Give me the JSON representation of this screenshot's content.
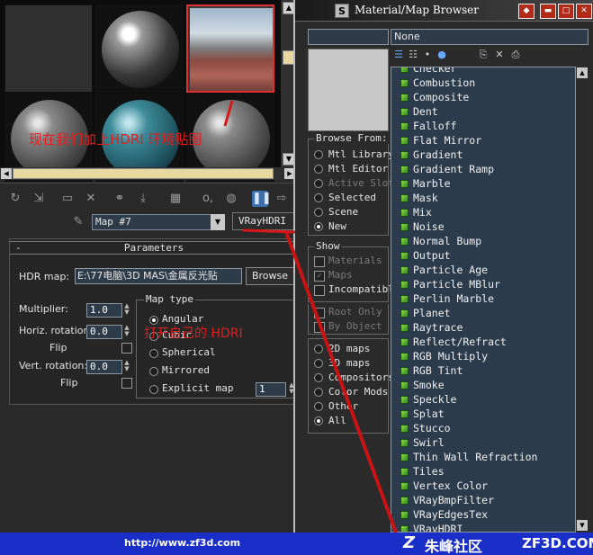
{
  "material_editor": {
    "map_name": "Map #7",
    "map_type_button": "VRayHDRI",
    "params": {
      "title": "Parameters",
      "collapse": "-",
      "hdr_map_label": "HDR map:",
      "hdr_map_path": "E:\\77电脑\\3D MAS\\金属反光贴",
      "browse_label": "Browse",
      "multiplier_label": "Multiplier:",
      "multiplier_value": "1.0",
      "horiz_rotation_label": "Horiz. rotation:",
      "horiz_rotation_value": "0.0",
      "flip_label": "Flip",
      "vert_rotation_label": "Vert. rotation:",
      "vert_rotation_value": "0.0",
      "flip2_label": "Flip",
      "map_type_title": "Map type",
      "map_types": [
        "Angular",
        "Cubic",
        "Spherical",
        "Mirrored",
        "Explicit map"
      ],
      "explicit_map_channel": "1"
    },
    "annotations": {
      "top": "现在我们加上HDRI 环境贴图",
      "mid": "打开自己的 HDRI"
    }
  },
  "browser": {
    "title": "Material/Map Browser",
    "title_icon": "S",
    "filter_value": "None",
    "browse_from": {
      "title": "Browse From:",
      "items": [
        {
          "label": "Mtl Library",
          "enabled": true,
          "selected": false
        },
        {
          "label": "Mtl Editor",
          "enabled": true,
          "selected": false
        },
        {
          "label": "Active Slot",
          "enabled": false,
          "selected": false
        },
        {
          "label": "Selected",
          "enabled": true,
          "selected": false
        },
        {
          "label": "Scene",
          "enabled": true,
          "selected": false
        },
        {
          "label": "New",
          "enabled": true,
          "selected": true
        }
      ]
    },
    "show": {
      "title": "Show",
      "items": [
        {
          "label": "Materials",
          "enabled": false,
          "checked": false
        },
        {
          "label": "Maps",
          "enabled": false,
          "checked": true
        },
        {
          "label": "Incompatible",
          "enabled": true,
          "checked": false
        }
      ],
      "extra": [
        {
          "label": "Root Only",
          "enabled": false
        },
        {
          "label": "By Object",
          "enabled": false
        }
      ]
    },
    "categories": {
      "items": [
        {
          "label": "2D maps",
          "selected": false
        },
        {
          "label": "3D maps",
          "selected": false
        },
        {
          "label": "Compositors",
          "selected": false
        },
        {
          "label": "Color Mods",
          "selected": false
        },
        {
          "label": "Other",
          "selected": false
        },
        {
          "label": "All",
          "selected": true
        }
      ]
    },
    "map_list": [
      "Checker",
      "Combustion",
      "Composite",
      "Dent",
      "Falloff",
      "Flat Mirror",
      "Gradient",
      "Gradient Ramp",
      "Marble",
      "Mask",
      "Mix",
      "Noise",
      "Normal Bump",
      "Output",
      "Particle Age",
      "Particle MBlur",
      "Perlin Marble",
      "Planet",
      "Raytrace",
      "Reflect/Refract",
      "RGB Multiply",
      "RGB Tint",
      "Smoke",
      "Speckle",
      "Splat",
      "Stucco",
      "Swirl",
      "Thin Wall Refraction",
      "Tiles",
      "Vertex Color",
      "VRayBmpFilter",
      "VRayEdgesTex",
      "VRayHDRI"
    ]
  },
  "footer": {
    "url": "http://www.zf3d.com",
    "site_name": "朱峰社区",
    "domain": "ZF3D.COM",
    "logo": "Z"
  },
  "colors": {
    "annotation_red": "#e02020",
    "footer_blue": "#1a2fc8",
    "list_bg": "#2d3c4c"
  }
}
